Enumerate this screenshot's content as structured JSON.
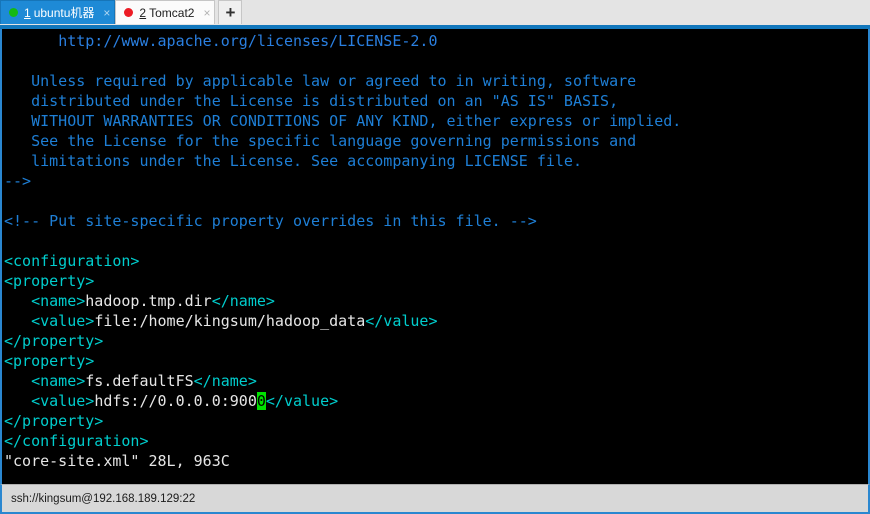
{
  "window": {
    "accent_color": "#1277bc",
    "frame_border_color": "#2a87d0"
  },
  "tabbar": {
    "tabs": [
      {
        "index": "1",
        "label": "ubuntu机器",
        "dot": "green-status-dot",
        "dot_color": "#15b915",
        "active": true,
        "close_glyph": "×"
      },
      {
        "index": "2",
        "label": "Tomcat2",
        "dot": "red-status-dot",
        "dot_color": "#ec1c24",
        "active": false,
        "close_glyph": "×"
      }
    ],
    "new_tab_glyph": "+"
  },
  "terminal": {
    "background": "#000000",
    "colors": {
      "comment": "#1e7fd6",
      "tag": "#00cdcd",
      "text": "#e6e6e6",
      "cursor": "#00e000"
    },
    "lines": [
      {
        "indent": "      ",
        "segments": [
          {
            "class": "c-url",
            "text": "http://www.apache.org/licenses/LICENSE-2.0"
          }
        ]
      },
      {
        "indent": "",
        "segments": []
      },
      {
        "indent": "   ",
        "segments": [
          {
            "class": "c-comment",
            "text": "Unless required by applicable law or agreed to in writing, software"
          }
        ]
      },
      {
        "indent": "   ",
        "segments": [
          {
            "class": "c-comment",
            "text": "distributed under the License is distributed on an \"AS IS\" BASIS,"
          }
        ]
      },
      {
        "indent": "   ",
        "segments": [
          {
            "class": "c-comment",
            "text": "WITHOUT WARRANTIES OR CONDITIONS OF ANY KIND, either express or implied."
          }
        ]
      },
      {
        "indent": "   ",
        "segments": [
          {
            "class": "c-comment",
            "text": "See the License for the specific language governing permissions and"
          }
        ]
      },
      {
        "indent": "   ",
        "segments": [
          {
            "class": "c-comment",
            "text": "limitations under the License. See accompanying LICENSE file."
          }
        ]
      },
      {
        "indent": "",
        "segments": [
          {
            "class": "c-comment",
            "text": "-->"
          }
        ]
      },
      {
        "indent": "",
        "segments": []
      },
      {
        "indent": "",
        "segments": [
          {
            "class": "c-comment",
            "text": "<!-- Put site-specific property overrides in this file. -->"
          }
        ]
      },
      {
        "indent": "",
        "segments": []
      },
      {
        "indent": "",
        "segments": [
          {
            "class": "c-tag",
            "text": "<configuration>"
          }
        ]
      },
      {
        "indent": "",
        "segments": [
          {
            "class": "c-tag",
            "text": "<property>"
          }
        ]
      },
      {
        "indent": "   ",
        "segments": [
          {
            "class": "c-tag",
            "text": "<name>"
          },
          {
            "class": "c-text",
            "text": "hadoop.tmp.dir"
          },
          {
            "class": "c-tag",
            "text": "</name>"
          }
        ]
      },
      {
        "indent": "   ",
        "segments": [
          {
            "class": "c-tag",
            "text": "<value>"
          },
          {
            "class": "c-text",
            "text": "file:/home/kingsum/hadoop_data"
          },
          {
            "class": "c-tag",
            "text": "</value>"
          }
        ]
      },
      {
        "indent": "",
        "segments": [
          {
            "class": "c-tag",
            "text": "</property>"
          }
        ]
      },
      {
        "indent": "",
        "segments": [
          {
            "class": "c-tag",
            "text": "<property>"
          }
        ]
      },
      {
        "indent": "   ",
        "segments": [
          {
            "class": "c-tag",
            "text": "<name>"
          },
          {
            "class": "c-text",
            "text": "fs.defaultFS"
          },
          {
            "class": "c-tag",
            "text": "</name>"
          }
        ]
      },
      {
        "indent": "   ",
        "segments": [
          {
            "class": "c-tag",
            "text": "<value>"
          },
          {
            "class": "c-text",
            "text": "hdfs://0.0.0.0:900"
          },
          {
            "class": "cursor",
            "text": "0"
          },
          {
            "class": "c-tag",
            "text": "</value>"
          }
        ]
      },
      {
        "indent": "",
        "segments": [
          {
            "class": "c-tag",
            "text": "</property>"
          }
        ]
      },
      {
        "indent": "",
        "segments": [
          {
            "class": "c-tag",
            "text": "</configuration>"
          }
        ]
      },
      {
        "indent": "",
        "segments": [
          {
            "class": "c-status",
            "text": "\"core-site.xml\" 28L, 963C"
          }
        ]
      }
    ]
  },
  "statusbar": {
    "connection": "ssh://kingsum@192.168.189.129:22"
  }
}
